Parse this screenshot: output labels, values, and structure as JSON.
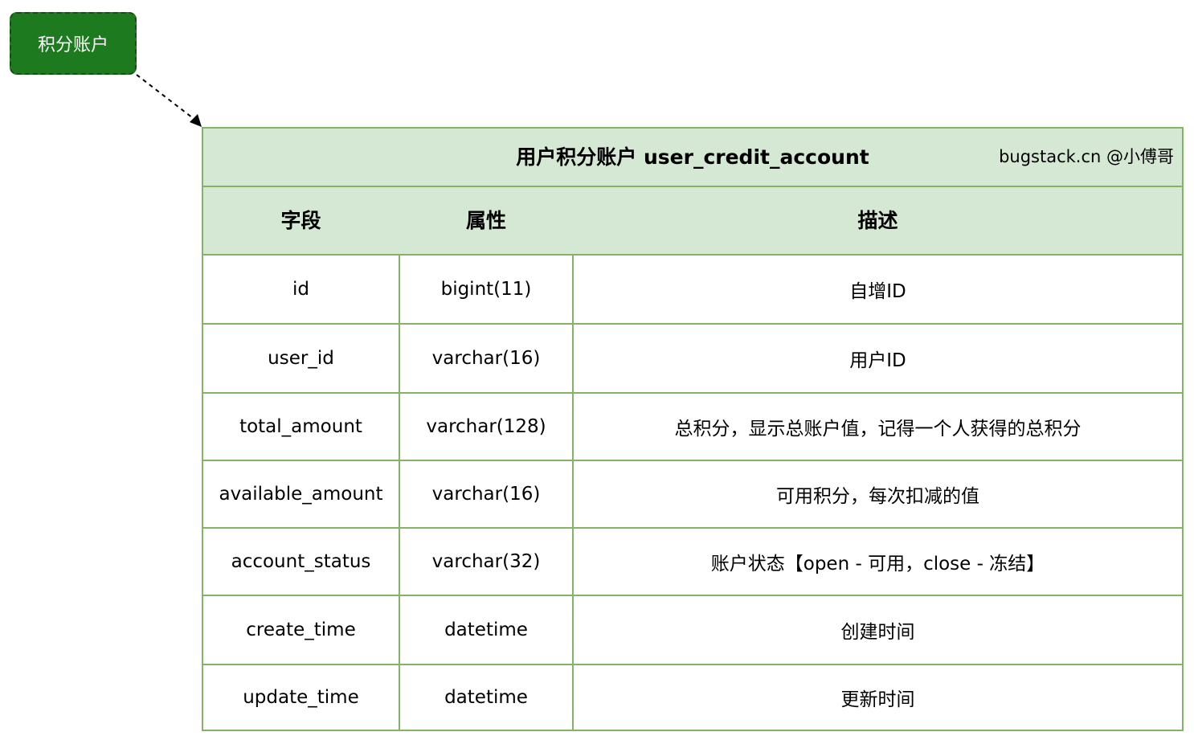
{
  "tag_node": {
    "label": "积分账户"
  },
  "table": {
    "title": "用户积分账户 user_credit_account",
    "credit": "bugstack.cn @小傅哥",
    "headers": [
      "字段",
      "属性",
      "描述"
    ],
    "rows": [
      {
        "field": "id",
        "type": "bigint(11)",
        "desc": "自增ID"
      },
      {
        "field": "user_id",
        "type": "varchar(16)",
        "desc": "用户ID"
      },
      {
        "field": "total_amount",
        "type": "varchar(128)",
        "desc": "总积分，显示总账户值，记得一个人获得的总积分"
      },
      {
        "field": "available_amount",
        "type": "varchar(16)",
        "desc": "可用积分，每次扣减的值"
      },
      {
        "field": "account_status",
        "type": "varchar(32)",
        "desc": "账户状态【open - 可用，close - 冻结】"
      },
      {
        "field": "create_time",
        "type": "datetime",
        "desc": "创建时间"
      },
      {
        "field": "update_time",
        "type": "datetime",
        "desc": "更新时间"
      }
    ]
  },
  "colors": {
    "node_fill": "#1e7a1e",
    "header_fill": "#d5e8d4",
    "border": "#82b366"
  }
}
